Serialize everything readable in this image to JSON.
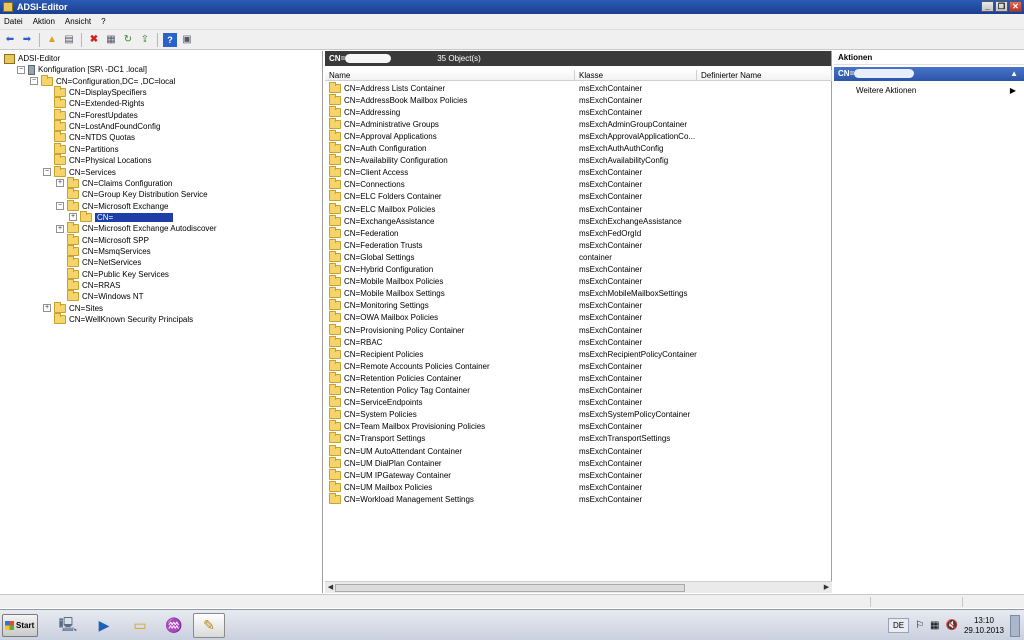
{
  "window": {
    "title": "ADSI-Editor"
  },
  "menu": [
    "Datei",
    "Aktion",
    "Ansicht",
    "?"
  ],
  "tree": {
    "rows": [
      {
        "level": 0,
        "label": "ADSI-Editor",
        "icon": "adsi",
        "expander": ""
      },
      {
        "level": 1,
        "label": "Konfiguration [SR\\              -DC1                    .local]",
        "icon": "server",
        "expander": "−"
      },
      {
        "level": 2,
        "label": "CN=Configuration,DC=                  ,DC=local",
        "icon": "folder",
        "expander": "−"
      },
      {
        "level": 3,
        "label": "CN=DisplaySpecifiers",
        "icon": "folder",
        "expander": ""
      },
      {
        "level": 3,
        "label": "CN=Extended-Rights",
        "icon": "folder",
        "expander": ""
      },
      {
        "level": 3,
        "label": "CN=ForestUpdates",
        "icon": "folder",
        "expander": ""
      },
      {
        "level": 3,
        "label": "CN=LostAndFoundConfig",
        "icon": "folder",
        "expander": ""
      },
      {
        "level": 3,
        "label": "CN=NTDS Quotas",
        "icon": "folder",
        "expander": ""
      },
      {
        "level": 3,
        "label": "CN=Partitions",
        "icon": "folder",
        "expander": ""
      },
      {
        "level": 3,
        "label": "CN=Physical Locations",
        "icon": "folder",
        "expander": ""
      },
      {
        "level": 3,
        "label": "CN=Services",
        "icon": "folder",
        "expander": "−"
      },
      {
        "level": 4,
        "label": "CN=Claims Configuration",
        "icon": "folder",
        "expander": "+"
      },
      {
        "level": 4,
        "label": "CN=Group Key Distribution Service",
        "icon": "folder",
        "expander": ""
      },
      {
        "level": 4,
        "label": "CN=Microsoft Exchange",
        "icon": "folder",
        "expander": "−"
      },
      {
        "level": 5,
        "label": "CN=",
        "icon": "folder",
        "expander": "+",
        "selected": true
      },
      {
        "level": 4,
        "label": "CN=Microsoft Exchange Autodiscover",
        "icon": "folder",
        "expander": "+"
      },
      {
        "level": 4,
        "label": "CN=Microsoft SPP",
        "icon": "folder",
        "expander": ""
      },
      {
        "level": 4,
        "label": "CN=MsmqServices",
        "icon": "folder",
        "expander": ""
      },
      {
        "level": 4,
        "label": "CN=NetServices",
        "icon": "folder",
        "expander": ""
      },
      {
        "level": 4,
        "label": "CN=Public Key Services",
        "icon": "folder",
        "expander": ""
      },
      {
        "level": 4,
        "label": "CN=RRAS",
        "icon": "folder",
        "expander": ""
      },
      {
        "level": 4,
        "label": "CN=Windows NT",
        "icon": "folder",
        "expander": ""
      },
      {
        "level": 3,
        "label": "CN=Sites",
        "icon": "folder",
        "expander": "+"
      },
      {
        "level": 3,
        "label": "CN=WellKnown Security Principals",
        "icon": "folder",
        "expander": ""
      }
    ]
  },
  "list": {
    "header_prefix": "CN=",
    "count": "35 Object(s)",
    "columns": [
      "Name",
      "Klasse",
      "Definierter Name"
    ],
    "rows": [
      [
        "CN=Address Lists Container",
        "msExchContainer"
      ],
      [
        "CN=AddressBook Mailbox Policies",
        "msExchContainer"
      ],
      [
        "CN=Addressing",
        "msExchContainer"
      ],
      [
        "CN=Administrative Groups",
        "msExchAdminGroupContainer"
      ],
      [
        "CN=Approval Applications",
        "msExchApprovalApplicationCo..."
      ],
      [
        "CN=Auth Configuration",
        "msExchAuthAuthConfig"
      ],
      [
        "CN=Availability Configuration",
        "msExchAvailabilityConfig"
      ],
      [
        "CN=Client Access",
        "msExchContainer"
      ],
      [
        "CN=Connections",
        "msExchContainer"
      ],
      [
        "CN=ELC Folders Container",
        "msExchContainer"
      ],
      [
        "CN=ELC Mailbox Policies",
        "msExchContainer"
      ],
      [
        "CN=ExchangeAssistance",
        "msExchExchangeAssistance"
      ],
      [
        "CN=Federation",
        "msExchFedOrgId"
      ],
      [
        "CN=Federation Trusts",
        "msExchContainer"
      ],
      [
        "CN=Global Settings",
        "container"
      ],
      [
        "CN=Hybrid Configuration",
        "msExchContainer"
      ],
      [
        "CN=Mobile Mailbox Policies",
        "msExchContainer"
      ],
      [
        "CN=Mobile Mailbox Settings",
        "msExchMobileMailboxSettings"
      ],
      [
        "CN=Monitoring Settings",
        "msExchContainer"
      ],
      [
        "CN=OWA Mailbox Policies",
        "msExchContainer"
      ],
      [
        "CN=Provisioning Policy Container",
        "msExchContainer"
      ],
      [
        "CN=RBAC",
        "msExchContainer"
      ],
      [
        "CN=Recipient Policies",
        "msExchRecipientPolicyContainer"
      ],
      [
        "CN=Remote Accounts Policies Container",
        "msExchContainer"
      ],
      [
        "CN=Retention Policies Container",
        "msExchContainer"
      ],
      [
        "CN=Retention Policy Tag Container",
        "msExchContainer"
      ],
      [
        "CN=ServiceEndpoints",
        "msExchContainer"
      ],
      [
        "CN=System Policies",
        "msExchSystemPolicyContainer"
      ],
      [
        "CN=Team Mailbox Provisioning Policies",
        "msExchContainer"
      ],
      [
        "CN=Transport Settings",
        "msExchTransportSettings"
      ],
      [
        "CN=UM AutoAttendant Container",
        "msExchContainer"
      ],
      [
        "CN=UM DialPlan Container",
        "msExchContainer"
      ],
      [
        "CN=UM IPGateway Container",
        "msExchContainer"
      ],
      [
        "CN=UM Mailbox Policies",
        "msExchContainer"
      ],
      [
        "CN=Workload Management Settings",
        "msExchContainer"
      ]
    ]
  },
  "actions": {
    "title": "Aktionen",
    "group": "CN=",
    "items": [
      "Weitere Aktionen"
    ]
  },
  "taskbar": {
    "start": "Start",
    "language": "DE",
    "time": "13:10",
    "date": "29.10.2013"
  }
}
